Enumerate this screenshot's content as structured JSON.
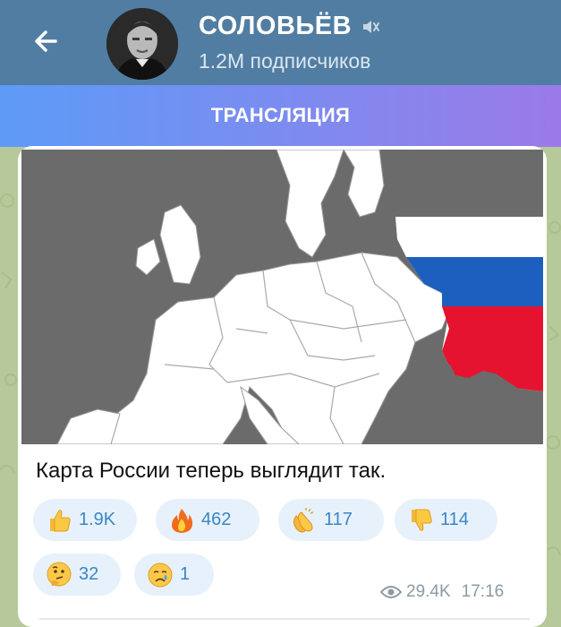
{
  "header": {
    "channel_name": "СОЛОВЬЁВ",
    "subscribers": "1.2M подписчиков",
    "back_icon": "arrow-left-icon",
    "mute_icon": "muted-speaker-icon",
    "bg_color": "#517da2"
  },
  "banner": {
    "label": "ТРАНСЛЯЦИЯ"
  },
  "message": {
    "caption": "Карта России теперь выглядит так.",
    "reactions": [
      {
        "emoji": "thumbs-up",
        "count": "1.9K"
      },
      {
        "emoji": "fire",
        "count": "462"
      },
      {
        "emoji": "clapping-hands",
        "count": "117"
      },
      {
        "emoji": "thumbs-down",
        "count": "114"
      },
      {
        "emoji": "thinking-face",
        "count": "32"
      },
      {
        "emoji": "crying-face",
        "count": "1"
      }
    ],
    "views": "29.4K",
    "time": "17:16",
    "flag_colors": [
      "#ffffff",
      "#1c5fbf",
      "#e5132f"
    ]
  }
}
